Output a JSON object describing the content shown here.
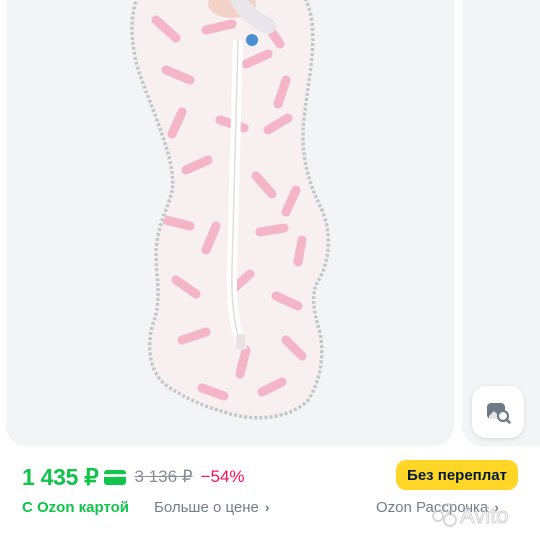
{
  "product": {
    "image_alt": "pink patterned baby swaddle sleep bag with white zipper",
    "colors": {
      "fabric": "#f7eef0",
      "pattern": "#f2a9bf",
      "trim": "#c8c8cc",
      "zipper": "#fbf8f8"
    }
  },
  "pricing": {
    "price": "1 435 ₽",
    "old_price": "3 136 ₽",
    "discount": "−54%",
    "ozon_card_label": "С Ozon картой",
    "more_about_price": "Больше о цене",
    "badge": "Без переплат",
    "installment": "Ozon Рассрочка"
  },
  "icons": {
    "card": "ozon-card-icon",
    "lens": "image-search-icon",
    "chevron": "chevron-right-icon",
    "watermark": "avito-watermark"
  },
  "watermark_text": "Avito",
  "theme": {
    "green": "#10c44c",
    "red": "#f91155",
    "yellow": "#ffd526",
    "gray": "#707f8d"
  }
}
